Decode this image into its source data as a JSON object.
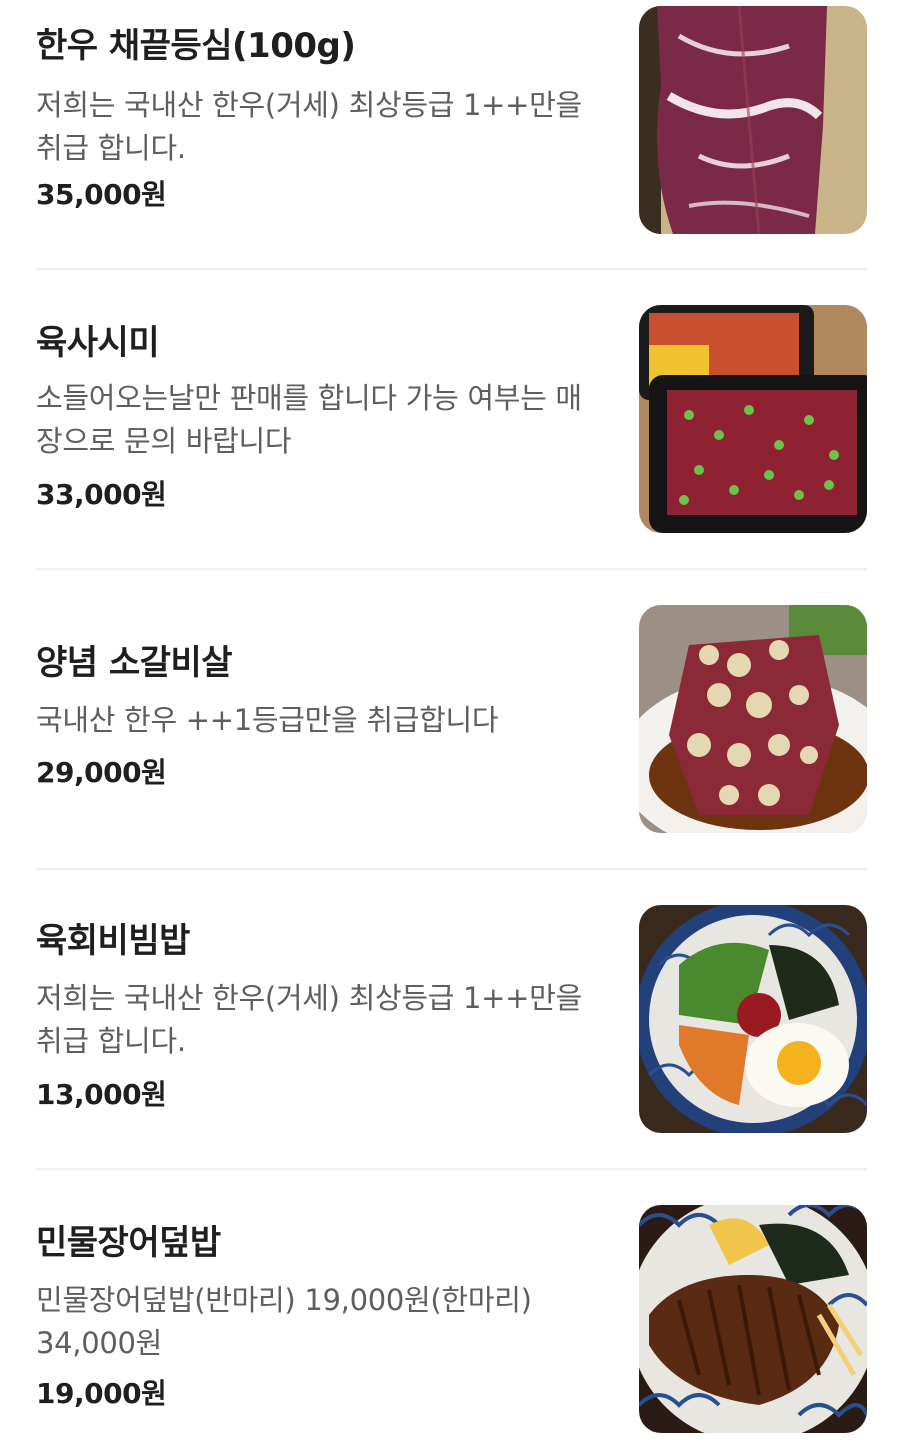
{
  "menu": {
    "items": [
      {
        "name": "한우 채끝등심(100g)",
        "description": "저희는 국내산 한우(거세) 최상등급 1++만을 취급 합니다.",
        "price": "35,000원",
        "image_icon": "beef-sirloin-photo"
      },
      {
        "name": "육사시미",
        "description": "소들어오는날만 판매를 합니다 가능 여부는 매장으로 문의 바랍니다",
        "price": "33,000원",
        "image_icon": "raw-beef-sashimi-photo"
      },
      {
        "name": "양념 소갈비살",
        "description": "국내산 한우 ++1등급만을 취급합니다",
        "price": "29,000원",
        "image_icon": "marinated-rib-photo"
      },
      {
        "name": "육회비빔밥",
        "description": "저희는 국내산 한우(거세) 최상등급 1++만을 취급 합니다.",
        "price": "13,000원",
        "image_icon": "yukhoe-bibimbap-photo"
      },
      {
        "name": "민물장어덮밥",
        "description": "민물장어덮밥(반마리) 19,000원(한마리) 34,000원",
        "price": "19,000원",
        "image_icon": "eel-rice-bowl-photo"
      }
    ]
  }
}
